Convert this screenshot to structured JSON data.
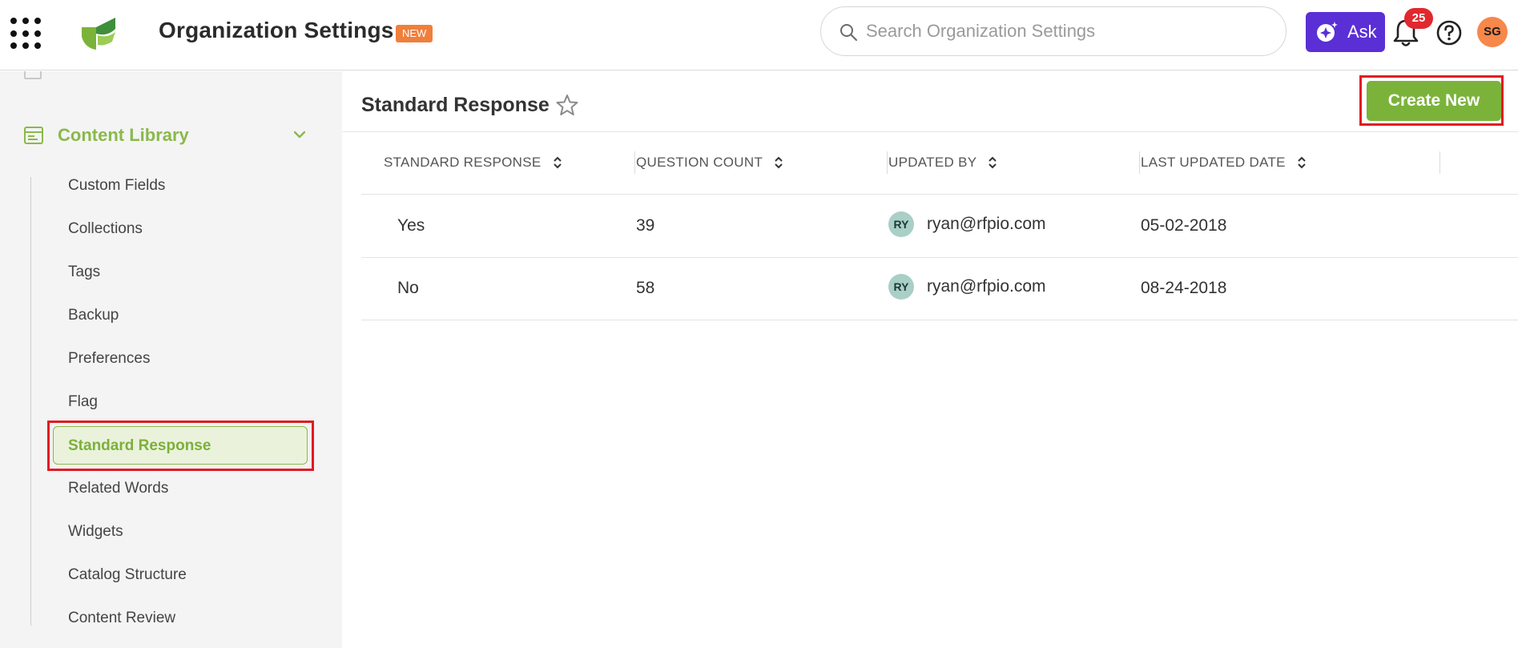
{
  "header": {
    "title": "Organization Settings",
    "new_badge": "NEW",
    "search_placeholder": "Search Organization Settings",
    "ask_label": "Ask",
    "notification_count": "25",
    "user_initials": "SG"
  },
  "sidebar": {
    "section_label": "Content Library",
    "items": [
      {
        "label": "Custom Fields"
      },
      {
        "label": "Collections"
      },
      {
        "label": "Tags"
      },
      {
        "label": "Backup"
      },
      {
        "label": "Preferences"
      },
      {
        "label": "Flag"
      },
      {
        "label": "Standard Response",
        "active": true
      },
      {
        "label": "Related Words"
      },
      {
        "label": "Widgets"
      },
      {
        "label": "Catalog Structure"
      },
      {
        "label": "Content Review"
      }
    ]
  },
  "main": {
    "page_title": "Standard Response",
    "create_button": "Create New",
    "columns": [
      "STANDARD RESPONSE",
      "QUESTION COUNT",
      "UPDATED BY",
      "LAST UPDATED DATE"
    ],
    "rows": [
      {
        "response": "Yes",
        "question_count": "39",
        "initials": "RY",
        "updated_by": "ryan@rfpio.com",
        "updated_date": "05-02-2018"
      },
      {
        "response": "No",
        "question_count": "58",
        "initials": "RY",
        "updated_by": "ryan@rfpio.com",
        "updated_date": "08-24-2018"
      }
    ]
  },
  "colors": {
    "accent_green": "#7bb33a",
    "ask_purple": "#5a2fd6",
    "badge_orange": "#f07f3c",
    "highlight_red": "#e11b22"
  },
  "icons": [
    "apps-grid-icon",
    "logo-icon",
    "search-icon",
    "sparkle-icon",
    "bell-icon",
    "help-icon",
    "star-icon",
    "library-icon",
    "chevron-down-icon",
    "sort-icon"
  ]
}
